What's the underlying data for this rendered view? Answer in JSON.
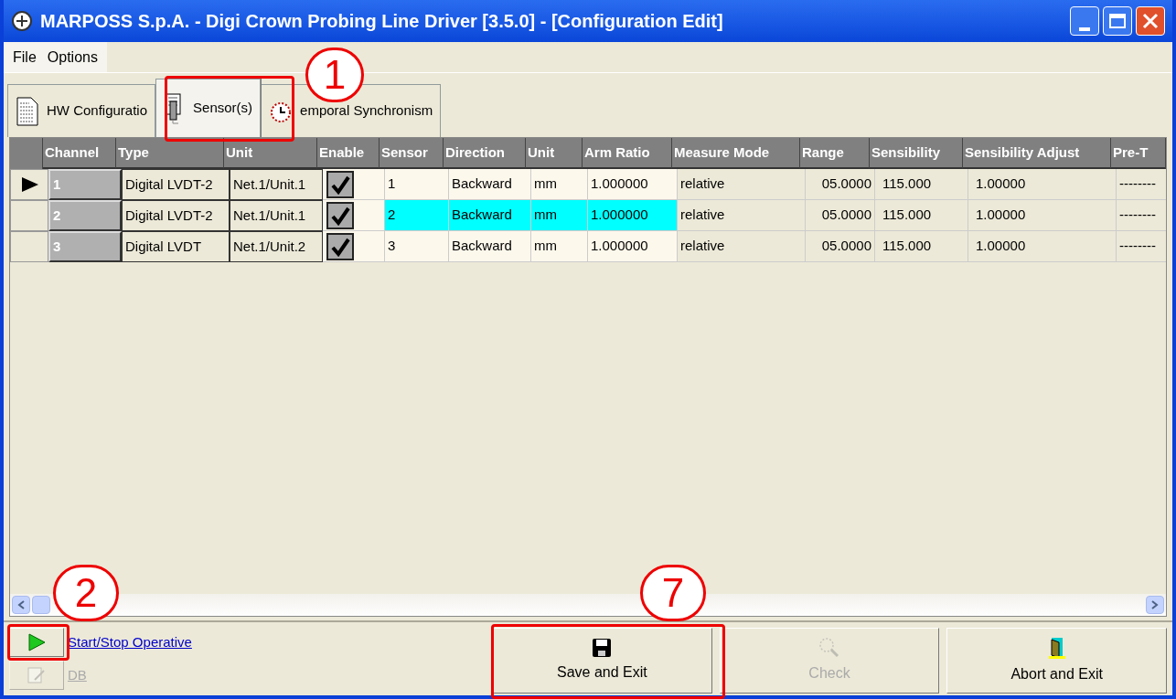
{
  "window": {
    "title": "MARPOSS S.p.A. - Digi Crown Probing Line Driver [3.5.0] - [Configuration Edit]"
  },
  "menu": [
    "File",
    "Options"
  ],
  "tabs": [
    {
      "label": "HW Configuratio",
      "selected": false
    },
    {
      "label": "Sensor(s)",
      "selected": true
    },
    {
      "label": "emporal Synchronism",
      "selected": false
    }
  ],
  "table": {
    "columns": [
      "Channel",
      "Type",
      "Unit",
      "Enable",
      "Sensor",
      "Direction",
      "Unit",
      "Arm Ratio",
      "Measure Mode",
      "Range",
      "Sensibility",
      "Sensibility Adjust",
      "Pre-T"
    ],
    "rows": [
      {
        "current": true,
        "selected": false,
        "enabled": true,
        "cells": [
          "1",
          "Digital LVDT-2",
          "Net.1/Unit.1",
          "",
          "1",
          "Backward",
          "mm",
          "1.000000",
          "relative",
          "05.0000",
          "115.000",
          "1.00000",
          "--------"
        ]
      },
      {
        "current": false,
        "selected": true,
        "enabled": true,
        "cells": [
          "2",
          "Digital LVDT-2",
          "Net.1/Unit.1",
          "",
          "2",
          "Backward",
          "mm",
          "1.000000",
          "relative",
          "05.0000",
          "115.000",
          "1.00000",
          "--------"
        ]
      },
      {
        "current": false,
        "selected": false,
        "enabled": true,
        "cells": [
          "3",
          "Digital LVDT",
          "Net.1/Unit.2",
          "",
          "3",
          "Backward",
          "mm",
          "1.000000",
          "relative",
          "05.0000",
          "115.000",
          "1.00000",
          "--------"
        ]
      }
    ]
  },
  "operative": {
    "link": "Start/Stop Operative",
    "db_label": "DB",
    "db_disabled": true
  },
  "buttons": [
    {
      "label": "Save and Exit",
      "disabled": false
    },
    {
      "label": "Check",
      "disabled": true
    },
    {
      "label": "Abort and Exit",
      "disabled": false
    }
  ],
  "callouts": [
    "1",
    "2",
    "7"
  ]
}
